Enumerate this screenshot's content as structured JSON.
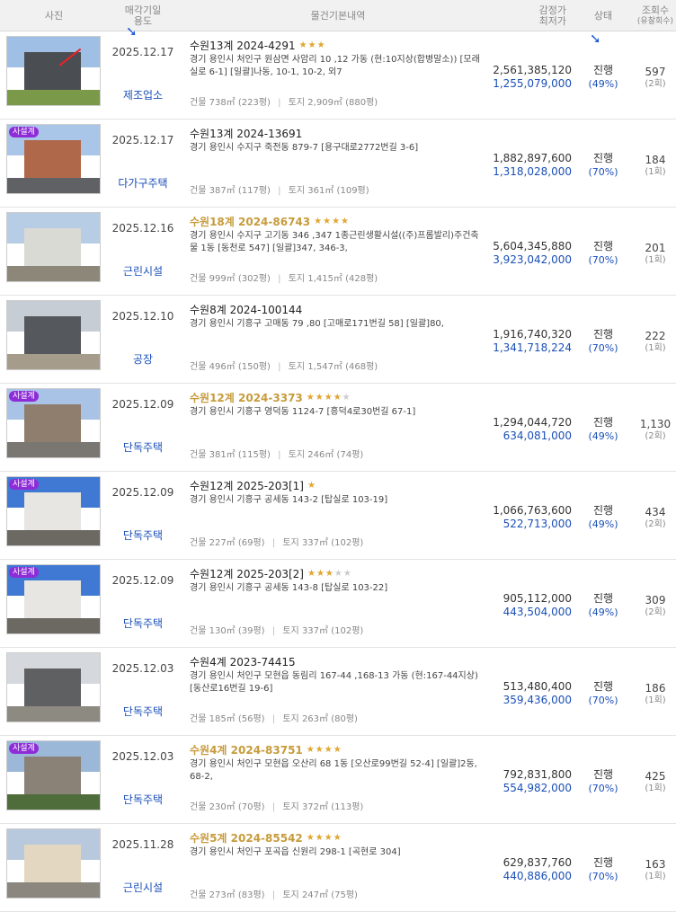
{
  "header": {
    "photo": "사진",
    "date_line1": "매각기일",
    "date_line2": "용도",
    "info": "물건기본내역",
    "price_line1": "감정가",
    "price_line2": "최저가",
    "status": "상태",
    "views_line1": "조회수",
    "views_line2": "(유찰회수)"
  },
  "colors": {
    "accent_blue": "#1a4fb8",
    "highlight_gold": "#c79b3b",
    "star": "#e0a631",
    "badge_purple": "#8e2dd8"
  },
  "area_labels": {
    "building": "건물",
    "land": "토지",
    "separator": "|"
  },
  "items": [
    {
      "badge": "",
      "date": "2025.12.17",
      "use": "제조업소",
      "case": "수원13계 2024-4291",
      "hl": false,
      "stars": 3,
      "addr": "경기 용인시 처인구 원삼면 사암리 10 ,12 가동 (현:10지상(합병말소)) [모래실로 6-1] [일괄]나동, 10-1, 10-2, 외7",
      "building": "738㎡ (223평)",
      "land": "2,909㎡ (880평)",
      "appraisal": "2,561,385,120",
      "minimum": "1,255,079,000",
      "status": "진행",
      "pct": "(49%)",
      "views": "597",
      "fail": "(2회)",
      "photo": "factory"
    },
    {
      "badge": "사설계",
      "date": "2025.12.17",
      "use": "다가구주택",
      "case": "수원13계 2024-13691",
      "hl": false,
      "stars": 0,
      "addr": "경기 용인시 수지구 죽전동 879-7 [용구대로2772번길 3-6]",
      "building": "387㎡ (117평)",
      "land": "361㎡ (109평)",
      "appraisal": "1,882,897,600",
      "minimum": "1,318,028,000",
      "status": "진행",
      "pct": "(70%)",
      "views": "184",
      "fail": "(1회)",
      "photo": "brick"
    },
    {
      "badge": "",
      "date": "2025.12.16",
      "use": "근린시설",
      "case": "수원18계 2024-86743",
      "hl": true,
      "stars": 4,
      "addr": "경기 용인시 수지구 고기동 346 ,347 1종근린생활시설((주)프롬발리)주건축물 1동 [동천로 547] [일괄]347, 346-3,",
      "building": "999㎡ (302평)",
      "land": "1,415㎡ (428평)",
      "appraisal": "5,604,345,880",
      "minimum": "3,923,042,000",
      "status": "진행",
      "pct": "(70%)",
      "views": "201",
      "fail": "(1회)",
      "photo": "white"
    },
    {
      "badge": "",
      "date": "2025.12.10",
      "use": "공장",
      "case": "수원8계 2024-100144",
      "hl": false,
      "stars": 0,
      "addr": "경기 용인시 기흥구 고매동 79 ,80 [고매로171번길 58] [일괄]80,",
      "building": "496㎡ (150평)",
      "land": "1,547㎡ (468평)",
      "appraisal": "1,916,740,320",
      "minimum": "1,341,718,224",
      "status": "진행",
      "pct": "(70%)",
      "views": "222",
      "fail": "(1회)",
      "photo": "warehouse"
    },
    {
      "badge": "사설계",
      "date": "2025.12.09",
      "use": "단독주택",
      "case": "수원12계 2024-3373",
      "hl": true,
      "stars": 4,
      "stars_off": 1,
      "addr": "경기 용인시 기흥구 영덕동 1124-7 [흥덕4로30번길 67-1]",
      "building": "381㎡ (115평)",
      "land": "246㎡ (74평)",
      "appraisal": "1,294,044,720",
      "minimum": "634,081,000",
      "status": "진행",
      "pct": "(49%)",
      "views": "1,130",
      "fail": "(2회)",
      "photo": "tan"
    },
    {
      "badge": "사설계",
      "date": "2025.12.09",
      "use": "단독주택",
      "case": "수원12계 2025-203[1]",
      "hl": false,
      "stars": 1,
      "addr": "경기 용인시 기흥구 공세동 143-2 [탑실로 103-19]",
      "building": "227㎡ (69평)",
      "land": "337㎡ (102평)",
      "appraisal": "1,066,763,600",
      "minimum": "522,713,000",
      "status": "진행",
      "pct": "(49%)",
      "views": "434",
      "fail": "(2회)",
      "photo": "modern"
    },
    {
      "badge": "사설계",
      "date": "2025.12.09",
      "use": "단독주택",
      "case": "수원12계 2025-203[2]",
      "hl": false,
      "stars": 3,
      "stars_off": 2,
      "addr": "경기 용인시 기흥구 공세동 143-8 [탑실로 103-22]",
      "building": "130㎡ (39평)",
      "land": "337㎡ (102평)",
      "appraisal": "905,112,000",
      "minimum": "443,504,000",
      "status": "진행",
      "pct": "(49%)",
      "views": "309",
      "fail": "(2회)",
      "photo": "modern"
    },
    {
      "badge": "",
      "date": "2025.12.03",
      "use": "단독주택",
      "case": "수원4계 2023-74415",
      "hl": false,
      "stars": 0,
      "addr": "경기 용인시 처인구 모현읍 동림리 167-44 ,168-13 가동 (현:167-44지상) [동산로16번길 19-6]",
      "building": "185㎡ (56평)",
      "land": "263㎡ (80평)",
      "appraisal": "513,480,400",
      "minimum": "359,436,000",
      "status": "진행",
      "pct": "(70%)",
      "views": "186",
      "fail": "(1회)",
      "photo": "gray"
    },
    {
      "badge": "사설계",
      "date": "2025.12.03",
      "use": "단독주택",
      "case": "수원4계 2024-83751",
      "hl": true,
      "stars": 4,
      "addr": "경기 용인시 처인구 모현읍 오산리 68 1동 [오산로99번길 52-4] [일괄]2동, 68-2,",
      "building": "230㎡ (70평)",
      "land": "372㎡ (113평)",
      "appraisal": "792,831,800",
      "minimum": "554,982,000",
      "status": "진행",
      "pct": "(70%)",
      "views": "425",
      "fail": "(1회)",
      "photo": "stone"
    },
    {
      "badge": "",
      "date": "2025.11.28",
      "use": "근린시설",
      "case": "수원5계 2024-85542",
      "hl": true,
      "stars": 4,
      "addr": "경기 용인시 처인구 포곡읍 신원리 298-1 [곡현로 304]",
      "building": "273㎡ (83평)",
      "land": "247㎡ (75평)",
      "appraisal": "629,837,760",
      "minimum": "440,886,000",
      "status": "진행",
      "pct": "(70%)",
      "views": "163",
      "fail": "(1회)",
      "photo": "cream"
    }
  ]
}
